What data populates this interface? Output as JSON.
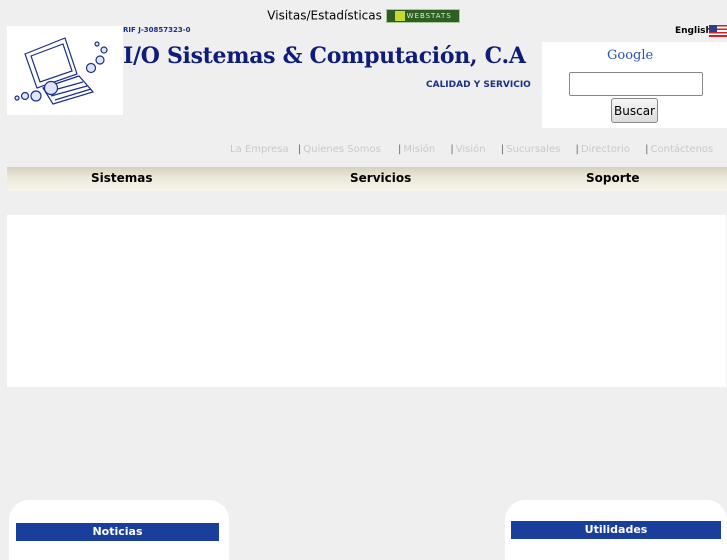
{
  "header": {
    "visits_label": "Visitas/Estadísticas",
    "webstats_badge": "WEBSTATS",
    "rif": "RIF J-30857323-0",
    "company_name": "I/O Sistemas & Computación, C.A",
    "slogan": "CALIDAD Y SERVICIO",
    "language_link": "English"
  },
  "search": {
    "brand": "Google",
    "button_label": "Buscar",
    "value": ""
  },
  "top_links": [
    "La Empresa",
    "Quienes Somos",
    "Misión",
    "Visión",
    "Sucursales",
    "Directorio",
    "Contáctenos"
  ],
  "menu": [
    "Sistemas",
    "Servicios",
    "Soporte"
  ],
  "panels": {
    "left_title": "Noticias",
    "right_title": "Utilidades"
  }
}
